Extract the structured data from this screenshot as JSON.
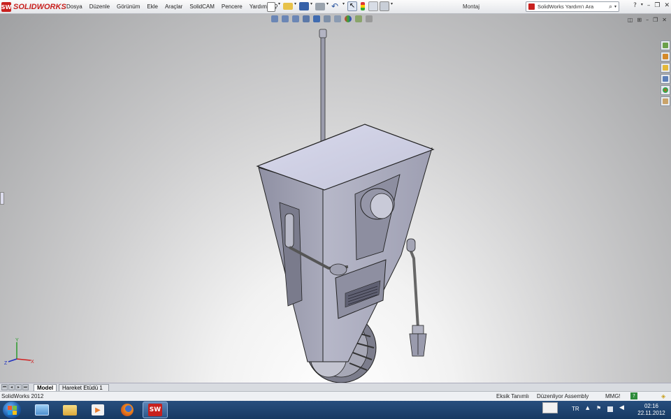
{
  "app": {
    "brand": "SOLIDWORKS",
    "window_title": "Montaj"
  },
  "menu": [
    "Dosya",
    "Düzenle",
    "Görünüm",
    "Ekle",
    "Araçlar",
    "SolidCAM",
    "Pencere",
    "Yardım"
  ],
  "search": {
    "placeholder": "SolidWorks Yardım'ı Ara"
  },
  "tabs": [
    {
      "label": "Model",
      "active": true
    },
    {
      "label": "Hareket Etüdü 1",
      "active": false
    }
  ],
  "status": {
    "version": "SolidWorks 2012",
    "definition": "Eksik Tanımlı",
    "mode": "Düzenliyor Assembly",
    "units": "MMG!"
  },
  "triad": {
    "x": "X",
    "y": "Y",
    "z": "Z"
  },
  "taskbar": {
    "language": "TR",
    "time": "02:16",
    "date": "22.11.2012"
  },
  "colors": {
    "brand_red": "#c8201e",
    "viewport_top": "#9fa0a2",
    "taskbar": "#1f4470"
  }
}
